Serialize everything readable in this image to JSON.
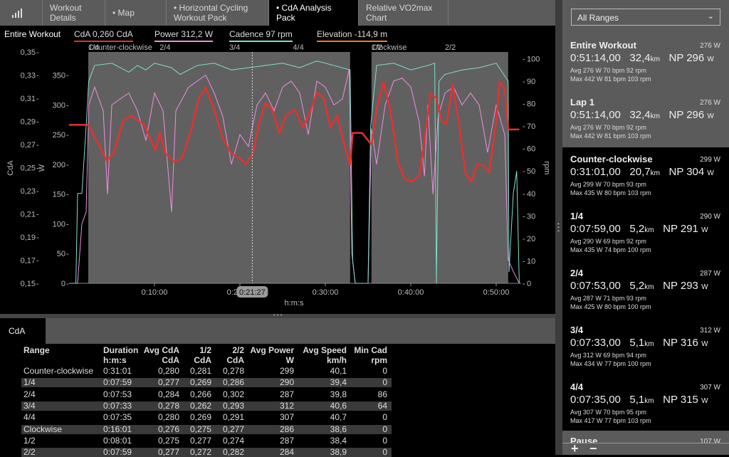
{
  "tabs": [
    {
      "label": "",
      "icon": "bar-chart-icon"
    },
    {
      "label": "Workout Details"
    },
    {
      "label": "• Map"
    },
    {
      "label": "• Horizontal Cycling Workout Pack"
    },
    {
      "label": "• CdA Analysis Pack",
      "active": true
    },
    {
      "label": "Relative VO2max Chart"
    }
  ],
  "legend": {
    "range": "Entire Workout",
    "cda": "CdA  0,260 CdA",
    "power": "Power  312,2 W",
    "cadence": "Cadence  97 rpm",
    "elevation": "Elevation  -114,9 m"
  },
  "colors": {
    "cda": "#e8302e",
    "power": "#f08ee0",
    "cadence": "#7fe0cc",
    "elevation": "#f07c2a",
    "range_shade": "#606060"
  },
  "chart_data": {
    "type": "line",
    "xlabel": "h:m:s",
    "x_unit": "minutes",
    "xlim": [
      0,
      52.7
    ],
    "x_ticks": [
      {
        "v": 10,
        "label": "0:10:00"
      },
      {
        "v": 20,
        "label": "0:20:00"
      },
      {
        "v": 30,
        "label": "0:30:00"
      },
      {
        "v": 40,
        "label": "0:40:00"
      },
      {
        "v": 50,
        "label": "0:50:00"
      }
    ],
    "cursor": {
      "v": 21.45,
      "label": "0:21:27"
    },
    "axes": {
      "cda": {
        "label": "CdA",
        "range": [
          0.15,
          0.35
        ],
        "ticks": [
          "0,35",
          "0,33",
          "0,31",
          "0,29",
          "0,27",
          "0,25",
          "0,23",
          "0,21",
          "0,19",
          "0,17",
          "0,15"
        ],
        "tick_values": [
          0.35,
          0.33,
          0.31,
          0.29,
          0.27,
          0.25,
          0.23,
          0.21,
          0.19,
          0.17,
          0.15
        ]
      },
      "power": {
        "label": "W",
        "range": [
          0,
          389
        ],
        "ticks": [
          "350",
          "300",
          "250",
          "200",
          "150",
          "100",
          "50",
          "0"
        ],
        "tick_values": [
          350,
          300,
          250,
          200,
          150,
          100,
          50,
          0
        ]
      },
      "rpm": {
        "label": "rpm",
        "range": [
          0,
          103
        ],
        "ticks": [
          "100",
          "90",
          "80",
          "70",
          "60",
          "50",
          "40",
          "30",
          "20",
          "10",
          "0"
        ],
        "tick_values": [
          100,
          90,
          80,
          70,
          60,
          50,
          40,
          30,
          20,
          10,
          0
        ]
      }
    },
    "ranges": [
      {
        "label": "Counter-clockwise",
        "start": 2.25,
        "end": 32.9
      },
      {
        "label": "Clockwise",
        "start": 35.4,
        "end": 51.4
      }
    ],
    "range_labels": [
      {
        "v": 2.25,
        "label": "Counter-clockwise"
      },
      {
        "v": 2.25,
        "label": "1/4"
      },
      {
        "v": 10.6,
        "label": "2/4"
      },
      {
        "v": 18.75,
        "label": "3/4"
      },
      {
        "v": 26.2,
        "label": "4/4"
      },
      {
        "v": 35.4,
        "label": "Clockwise"
      },
      {
        "v": 35.4,
        "label": "1/2"
      },
      {
        "v": 44,
        "label": "2/2"
      }
    ],
    "series": [
      {
        "name": "CdA",
        "axis": "cda",
        "points": [
          [
            0,
            0.287
          ],
          [
            2.2,
            0.287
          ],
          [
            3.5,
            0.27
          ],
          [
            4.4,
            0.256
          ],
          [
            5.2,
            0.262
          ],
          [
            6.3,
            0.29
          ],
          [
            7.2,
            0.295
          ],
          [
            8.8,
            0.287
          ],
          [
            9.5,
            0.275
          ],
          [
            10.1,
            0.265
          ],
          [
            10.6,
            0.28
          ],
          [
            11.3,
            0.262
          ],
          [
            12.3,
            0.255
          ],
          [
            13.2,
            0.258
          ],
          [
            14.2,
            0.28
          ],
          [
            15.2,
            0.31
          ],
          [
            16,
            0.319
          ],
          [
            17,
            0.3
          ],
          [
            18,
            0.275
          ],
          [
            19,
            0.262
          ],
          [
            20,
            0.258
          ],
          [
            20.7,
            0.253
          ],
          [
            21.5,
            0.262
          ],
          [
            22.3,
            0.29
          ],
          [
            23,
            0.306
          ],
          [
            23.8,
            0.3
          ],
          [
            24.6,
            0.28
          ],
          [
            25.4,
            0.295
          ],
          [
            26.4,
            0.3
          ],
          [
            27.4,
            0.285
          ],
          [
            28.3,
            0.3
          ],
          [
            29,
            0.315
          ],
          [
            29.8,
            0.31
          ],
          [
            30.6,
            0.285
          ],
          [
            31.4,
            0.295
          ],
          [
            32.2,
            0.27
          ],
          [
            32.9,
            0.252
          ],
          [
            33.2,
            0.28
          ],
          [
            34.3,
            0.28
          ],
          [
            35.4,
            0.27
          ],
          [
            36,
            0.3
          ],
          [
            36.8,
            0.324
          ],
          [
            37.6,
            0.3
          ],
          [
            38.5,
            0.255
          ],
          [
            39.3,
            0.24
          ],
          [
            40.2,
            0.238
          ],
          [
            41,
            0.243
          ],
          [
            41.8,
            0.285
          ],
          [
            42.3,
            0.314
          ],
          [
            43,
            0.31
          ],
          [
            43.6,
            0.29
          ],
          [
            44.2,
            0.288
          ],
          [
            44.9,
            0.322
          ],
          [
            45.6,
            0.29
          ],
          [
            46.4,
            0.245
          ],
          [
            47.1,
            0.238
          ],
          [
            47.8,
            0.253
          ],
          [
            48.5,
            0.252
          ],
          [
            49.2,
            0.246
          ],
          [
            50,
            0.29
          ],
          [
            50.4,
            0.324
          ],
          [
            51,
            0.318
          ],
          [
            51.4,
            0.283
          ],
          [
            52.7,
            0.283
          ]
        ]
      },
      {
        "name": "Power",
        "axis": "power",
        "points": [
          [
            0,
            0
          ],
          [
            1,
            0
          ],
          [
            1.5,
            100
          ],
          [
            2,
            120
          ],
          [
            2.3,
            300
          ],
          [
            3,
            330
          ],
          [
            4,
            290
          ],
          [
            4.5,
            150
          ],
          [
            5,
            300
          ],
          [
            6,
            310
          ],
          [
            7,
            320
          ],
          [
            8,
            290
          ],
          [
            9,
            240
          ],
          [
            10,
            320
          ],
          [
            11,
            290
          ],
          [
            12,
            120
          ],
          [
            12.5,
            290
          ],
          [
            14,
            330
          ],
          [
            16,
            350
          ],
          [
            17,
            320
          ],
          [
            18,
            280
          ],
          [
            19,
            200
          ],
          [
            20,
            250
          ],
          [
            21,
            230
          ],
          [
            22,
            300
          ],
          [
            23,
            320
          ],
          [
            24,
            290
          ],
          [
            25,
            330
          ],
          [
            26,
            340
          ],
          [
            27,
            320
          ],
          [
            28,
            250
          ],
          [
            29,
            340
          ],
          [
            30,
            330
          ],
          [
            31,
            300
          ],
          [
            32,
            310
          ],
          [
            32.8,
            360
          ],
          [
            33.1,
            50
          ],
          [
            33.5,
            0
          ],
          [
            35,
            0
          ],
          [
            35.4,
            260
          ],
          [
            36,
            200
          ],
          [
            37,
            300
          ],
          [
            38,
            340
          ],
          [
            39,
            345
          ],
          [
            40,
            330
          ],
          [
            41,
            270
          ],
          [
            41.6,
            180
          ],
          [
            42,
            300
          ],
          [
            42.6,
            150
          ],
          [
            43.2,
            280
          ],
          [
            44,
            320
          ],
          [
            45,
            330
          ],
          [
            46,
            300
          ],
          [
            47,
            320
          ],
          [
            48,
            300
          ],
          [
            49,
            220
          ],
          [
            50,
            300
          ],
          [
            51,
            250
          ],
          [
            51.4,
            40
          ],
          [
            52,
            20
          ],
          [
            52.7,
            0
          ]
        ]
      },
      {
        "name": "Cadence",
        "axis": "rpm",
        "points": [
          [
            0,
            0
          ],
          [
            0.8,
            0
          ],
          [
            1,
            40
          ],
          [
            1.5,
            40
          ],
          [
            2,
            70
          ],
          [
            2.3,
            90
          ],
          [
            3,
            97
          ],
          [
            5,
            98
          ],
          [
            7,
            94
          ],
          [
            8,
            97
          ],
          [
            9,
            95
          ],
          [
            10,
            98
          ],
          [
            12,
            96
          ],
          [
            13,
            93
          ],
          [
            15,
            97
          ],
          [
            17,
            98
          ],
          [
            19,
            95
          ],
          [
            21,
            96
          ],
          [
            23,
            97
          ],
          [
            25,
            98
          ],
          [
            27,
            96
          ],
          [
            29,
            99
          ],
          [
            31,
            97
          ],
          [
            32.9,
            95
          ],
          [
            33.2,
            10
          ],
          [
            33.5,
            0
          ],
          [
            35,
            0
          ],
          [
            35.3,
            70
          ],
          [
            36,
            97
          ],
          [
            38,
            98
          ],
          [
            40,
            95
          ],
          [
            42,
            97
          ],
          [
            42.8,
            98
          ],
          [
            43,
            0
          ],
          [
            43.3,
            90
          ],
          [
            44,
            93
          ],
          [
            46,
            95
          ],
          [
            48,
            96
          ],
          [
            50,
            98
          ],
          [
            51.4,
            90
          ],
          [
            51.5,
            5
          ],
          [
            52,
            40
          ],
          [
            52.4,
            50
          ],
          [
            52.7,
            0
          ]
        ]
      }
    ]
  },
  "bottom": {
    "tab": "CdA",
    "headers": [
      [
        "Range",
        ""
      ],
      [
        "Duration",
        "h:m:s"
      ],
      [
        "Avg CdA",
        "CdA"
      ],
      [
        "1/2",
        "CdA"
      ],
      [
        "2/2",
        "CdA"
      ],
      [
        "Avg Power",
        "W"
      ],
      [
        "Avg Speed",
        "km/h"
      ],
      [
        "Min Cad",
        "rpm"
      ]
    ],
    "rows": [
      [
        "Counter-clockwise",
        "0:31:01",
        "0,280",
        "0,281",
        "0,278",
        "299",
        "40,1",
        "0"
      ],
      [
        "1/4",
        "0:07:59",
        "0,277",
        "0,269",
        "0,286",
        "290",
        "39,4",
        "0"
      ],
      [
        "2/4",
        "0:07:53",
        "0,284",
        "0,266",
        "0,302",
        "287",
        "39,8",
        "86"
      ],
      [
        "3/4",
        "0:07:33",
        "0,278",
        "0,262",
        "0,293",
        "312",
        "40,6",
        "64"
      ],
      [
        "4/4",
        "0:07:35",
        "0,280",
        "0,269",
        "0,291",
        "307",
        "40,7",
        "0"
      ],
      [
        "Clockwise",
        "0:16:01",
        "0,276",
        "0,275",
        "0,277",
        "286",
        "38,6",
        "0"
      ],
      [
        "1/2",
        "0:08:01",
        "0,275",
        "0,277",
        "0,274",
        "287",
        "38,4",
        "0"
      ],
      [
        "2/2",
        "0:07:59",
        "0,277",
        "0,272",
        "0,282",
        "284",
        "38,9",
        "0"
      ]
    ]
  },
  "sidebar": {
    "select": "All Ranges",
    "items": [
      {
        "title": "Entire Workout",
        "avg_w": "276 W",
        "time": "0:51:14,00",
        "dist": "32,4",
        "dist_unit": "km",
        "np": "NP 296",
        "np_unit": "W",
        "avg": "Avg  276 W  70 bpm  92 rpm",
        "max": "Max  442 W  81 bpm  103 rpm"
      },
      {
        "title": "Lap 1",
        "avg_w": "276 W",
        "time": "0:51:14,00",
        "dist": "32,4",
        "dist_unit": "km",
        "np": "NP 296",
        "np_unit": "W",
        "avg": "Avg  276 W  70 bpm  92 rpm",
        "max": "Max  442 W  81 bpm  103 rpm"
      },
      {
        "title": "Counter-clockwise",
        "avg_w": "299 W",
        "time": "0:31:01,00",
        "dist": "20,7",
        "dist_unit": "km",
        "np": "NP 304",
        "np_unit": "W",
        "avg": "Avg  299 W  70 bpm  93 rpm",
        "max": "Max  435 W  80 bpm  103 rpm"
      },
      {
        "title": "1/4",
        "avg_w": "290 W",
        "time": "0:07:59,00",
        "dist": "5,2",
        "dist_unit": "km",
        "np": "NP 291",
        "np_unit": "W",
        "avg": "Avg  290 W  69 bpm  92 rpm",
        "max": "Max  435 W  74 bpm  100 rpm"
      },
      {
        "title": "2/4",
        "avg_w": "287 W",
        "time": "0:07:53,00",
        "dist": "5,2",
        "dist_unit": "km",
        "np": "NP 293",
        "np_unit": "W",
        "avg": "Avg  287 W  71 bpm  93 rpm",
        "max": "Max  425 W  80 bpm  100 rpm"
      },
      {
        "title": "3/4",
        "avg_w": "312 W",
        "time": "0:07:33,00",
        "dist": "5,1",
        "dist_unit": "km",
        "np": "NP 316",
        "np_unit": "W",
        "avg": "Avg  312 W  69 bpm  94 rpm",
        "max": "Max  434 W  77 bpm  100 rpm"
      },
      {
        "title": "4/4",
        "avg_w": "307 W",
        "time": "0:07:35,00",
        "dist": "5,1",
        "dist_unit": "km",
        "np": "NP 315",
        "np_unit": "W",
        "avg": "Avg  307 W  70 bpm  95 rpm",
        "max": "Max  417 W  77 bpm  103 rpm"
      },
      {
        "title": "Pause",
        "avg_w": "107 W"
      }
    ],
    "add": "+",
    "remove": "−"
  }
}
